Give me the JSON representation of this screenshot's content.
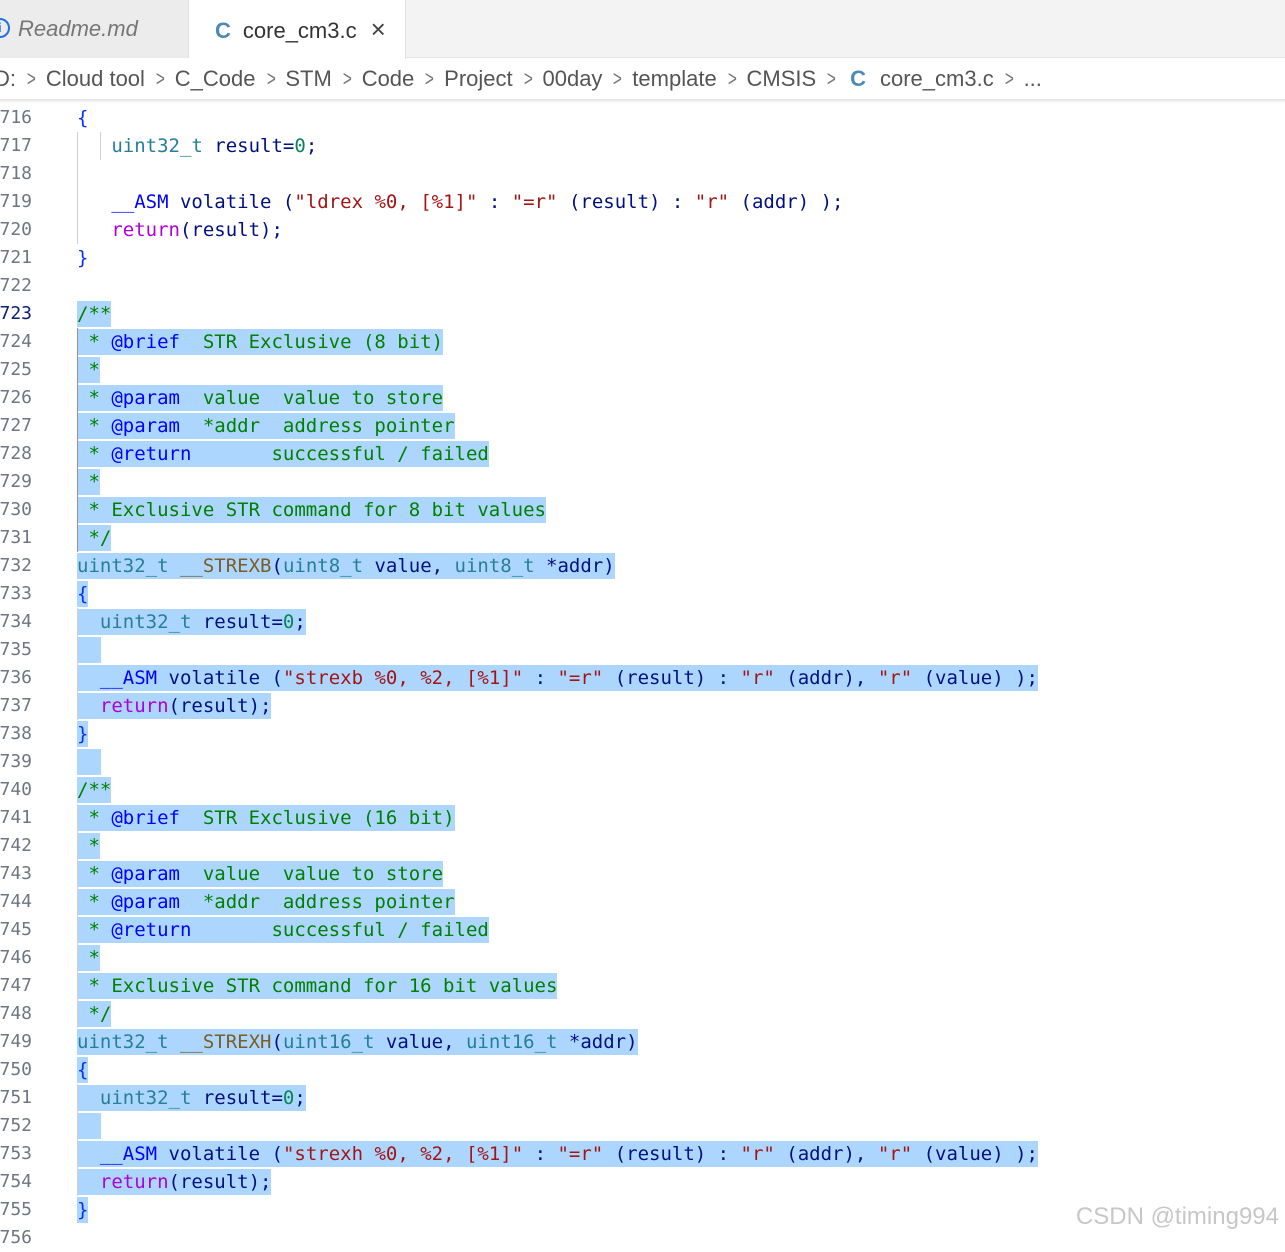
{
  "tabs": [
    {
      "label": "Readme.md",
      "icon": "info-icon",
      "active": false
    },
    {
      "label": "core_cm3.c",
      "icon": "c-file-icon",
      "active": true,
      "close": "×"
    }
  ],
  "breadcrumb": {
    "items": [
      "D:",
      "Cloud tool",
      "C_Code",
      "STM",
      "Code",
      "Project",
      "00day",
      "template",
      "CMSIS"
    ],
    "file_icon": "C",
    "file": "core_cm3.c",
    "more": "..."
  },
  "editor": {
    "active_line": "723",
    "lines": [
      {
        "n": "716",
        "text": "{"
      },
      {
        "n": "717",
        "text": "   uint32_t result=0;"
      },
      {
        "n": "718",
        "text": ""
      },
      {
        "n": "719",
        "text": "   __ASM volatile (\"ldrex %0, [%1]\" : \"=r\" (result) : \"r\" (addr) );"
      },
      {
        "n": "720",
        "text": "   return(result);"
      },
      {
        "n": "721",
        "text": "}"
      },
      {
        "n": "722",
        "text": ""
      },
      {
        "n": "723",
        "text": "/**"
      },
      {
        "n": "724",
        "text": " * @brief  STR Exclusive (8 bit)"
      },
      {
        "n": "725",
        "text": " *"
      },
      {
        "n": "726",
        "text": " * @param  value  value to store"
      },
      {
        "n": "727",
        "text": " * @param  *addr  address pointer"
      },
      {
        "n": "728",
        "text": " * @return       successful / failed"
      },
      {
        "n": "729",
        "text": " *"
      },
      {
        "n": "730",
        "text": " * Exclusive STR command for 8 bit values"
      },
      {
        "n": "731",
        "text": " */"
      },
      {
        "n": "732",
        "text": "uint32_t __STREXB(uint8_t value, uint8_t *addr)"
      },
      {
        "n": "733",
        "text": "{"
      },
      {
        "n": "734",
        "text": "  uint32_t result=0;"
      },
      {
        "n": "735",
        "text": ""
      },
      {
        "n": "736",
        "text": "  __ASM volatile (\"strexb %0, %2, [%1]\" : \"=r\" (result) : \"r\" (addr), \"r\" (value) );"
      },
      {
        "n": "737",
        "text": "  return(result);"
      },
      {
        "n": "738",
        "text": "}"
      },
      {
        "n": "739",
        "text": ""
      },
      {
        "n": "740",
        "text": "/**"
      },
      {
        "n": "741",
        "text": " * @brief  STR Exclusive (16 bit)"
      },
      {
        "n": "742",
        "text": " *"
      },
      {
        "n": "743",
        "text": " * @param  value  value to store"
      },
      {
        "n": "744",
        "text": " * @param  *addr  address pointer"
      },
      {
        "n": "745",
        "text": " * @return       successful / failed"
      },
      {
        "n": "746",
        "text": " *"
      },
      {
        "n": "747",
        "text": " * Exclusive STR command for 16 bit values"
      },
      {
        "n": "748",
        "text": " */"
      },
      {
        "n": "749",
        "text": "uint32_t __STREXH(uint16_t value, uint16_t *addr)"
      },
      {
        "n": "750",
        "text": "{"
      },
      {
        "n": "751",
        "text": "  uint32_t result=0;"
      },
      {
        "n": "752",
        "text": ""
      },
      {
        "n": "753",
        "text": "  __ASM volatile (\"strexh %0, %2, [%1]\" : \"=r\" (result) : \"r\" (addr), \"r\" (value) );"
      },
      {
        "n": "754",
        "text": "  return(result);"
      },
      {
        "n": "755",
        "text": "}"
      },
      {
        "n": "756",
        "text": ""
      }
    ]
  },
  "watermark": "CSDN @timing994",
  "colors": {
    "selection": "#add6ff",
    "comment": "#008000",
    "type": "#267f99",
    "function": "#795e26",
    "string": "#a31515",
    "number": "#098658",
    "control": "#af00db",
    "keyword": "#0000ff"
  }
}
